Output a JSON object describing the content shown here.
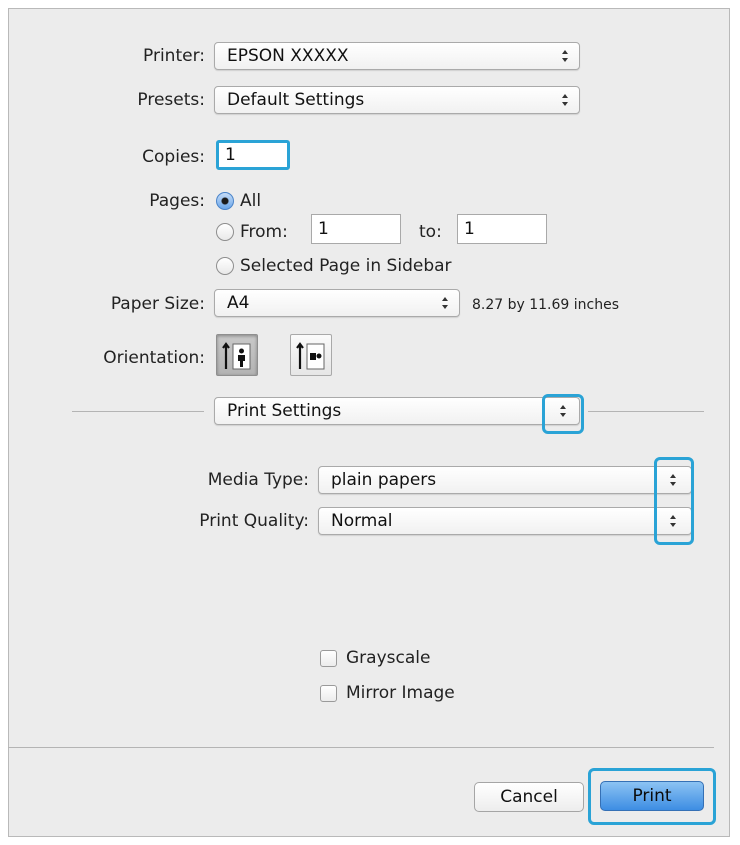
{
  "printer": {
    "label": "Printer:",
    "value": "EPSON XXXXX"
  },
  "presets": {
    "label": "Presets:",
    "value": "Default Settings"
  },
  "copies": {
    "label": "Copies:",
    "value": "1"
  },
  "pages": {
    "label": "Pages:",
    "all_label": "All",
    "from_label": "From:",
    "from_value": "1",
    "to_label": "to:",
    "to_value": "1",
    "selected_label": "Selected Page in Sidebar",
    "selected_option": "All"
  },
  "paper_size": {
    "label": "Paper Size:",
    "value": "A4",
    "dimensions": "8.27 by 11.69 inches"
  },
  "orientation": {
    "label": "Orientation:",
    "options": [
      "portrait-icon",
      "landscape-icon"
    ],
    "selected": "portrait-icon"
  },
  "section": {
    "value": "Print Settings"
  },
  "media_type": {
    "label": "Media Type:",
    "value": "plain papers"
  },
  "print_quality": {
    "label": "Print Quality:",
    "value": "Normal"
  },
  "options": {
    "grayscale_label": "Grayscale",
    "mirror_label": "Mirror Image",
    "grayscale_checked": false,
    "mirror_checked": false
  },
  "buttons": {
    "cancel": "Cancel",
    "print": "Print"
  },
  "colors": {
    "highlight": "#2aa3d6",
    "print_button": "#3d8de3"
  }
}
